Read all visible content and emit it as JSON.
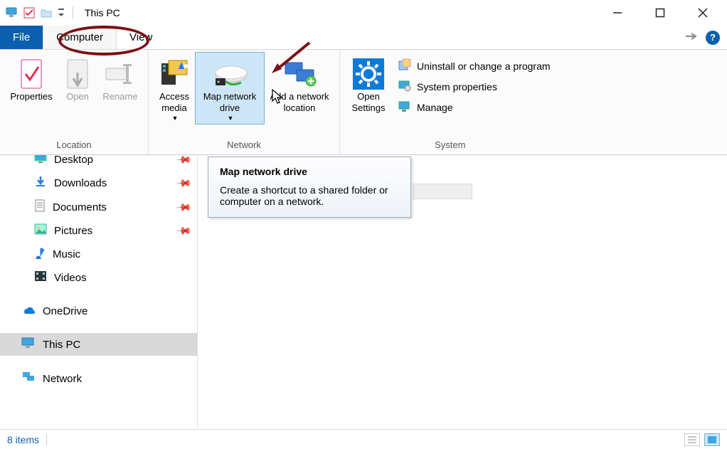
{
  "titlebar": {
    "title": "This PC"
  },
  "tabs": {
    "file": "File",
    "computer": "Computer",
    "view": "View"
  },
  "ribbon": {
    "location": {
      "label": "Location",
      "properties": "Properties",
      "open": "Open",
      "rename": "Rename"
    },
    "network": {
      "label": "Network",
      "access_media": "Access media",
      "map_drive": "Map network drive",
      "add_location": "Add a network location"
    },
    "system": {
      "label": "System",
      "open_settings": "Open Settings",
      "uninstall": "Uninstall or change a program",
      "system_props": "System properties",
      "manage": "Manage"
    }
  },
  "tooltip": {
    "title": "Map network drive",
    "body": "Create a shortcut to a shared folder or computer on a network."
  },
  "sidebar": {
    "desktop": "Desktop",
    "downloads": "Downloads",
    "documents": "Documents",
    "pictures": "Pictures",
    "music": "Music",
    "videos": "Videos",
    "onedrive": "OneDrive",
    "thispc": "This PC",
    "network": "Network"
  },
  "statusbar": {
    "items": "8 items"
  }
}
